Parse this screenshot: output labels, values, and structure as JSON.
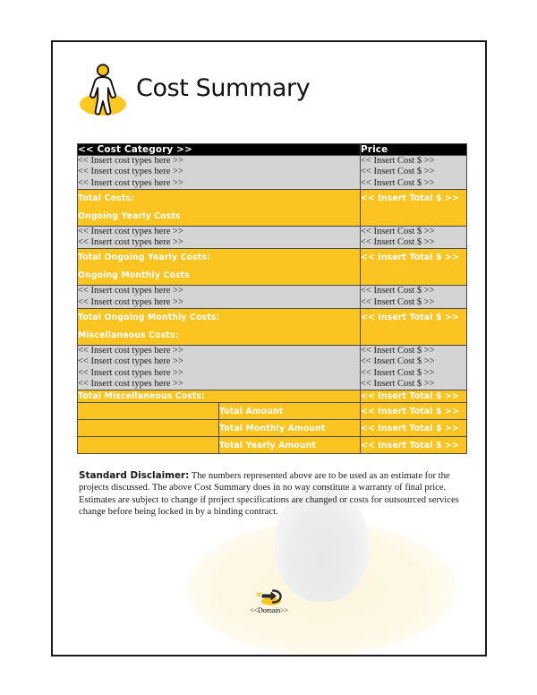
{
  "document": {
    "title": "Cost Summary",
    "logo_icon": "person-on-disc-icon"
  },
  "table": {
    "header": {
      "category": "<< Cost Category >>",
      "price": "Price"
    },
    "item_placeholder": "<< Insert cost types here >>",
    "cost_placeholder": "<< Insert Cost $ >>",
    "total_placeholder": "<< Insert Total $ >>",
    "sections": [
      {
        "kind": "items",
        "rows": 3
      },
      {
        "kind": "gold",
        "label_primary": "Total Costs:",
        "label_secondary": "Ongoing Yearly Costs",
        "value": "<< Insert Total $ >>"
      },
      {
        "kind": "items",
        "rows": 2
      },
      {
        "kind": "gold",
        "label_primary": "Total Ongoing Yearly Costs:",
        "label_secondary": "Ongoing Monthly Costs",
        "value": "<< Insert Total $ >>"
      },
      {
        "kind": "items",
        "rows": 2
      },
      {
        "kind": "gold",
        "label_primary": "Total Ongoing Monthly Costs:",
        "label_secondary": "Miscellaneous Costs:",
        "value": "<< Insert Total $ >>"
      },
      {
        "kind": "items",
        "rows": 4
      },
      {
        "kind": "gold-single",
        "label_primary": "Total Miscellaneous Costs:",
        "value": "<< Insert Total $ >>"
      }
    ],
    "summary_rows": [
      {
        "label": "Total Amount",
        "value": "<< Insert Total $ >>"
      },
      {
        "label": "Total Monthly Amount",
        "value": "<< Insert Total $ >>"
      },
      {
        "label": "Total Yearly Amount",
        "value": "<< Insert Total $ >>"
      }
    ]
  },
  "disclaimer": {
    "heading": "Standard Disclaimer:",
    "body": " The numbers represented above are to be used as an estimate for the projects discussed. The above Cost Summary does in no way constitute a warranty of final price. Estimates are subject to change if project specifications are changed or costs for outsourced services change before being locked in by a binding contract."
  },
  "footer": {
    "domain": "<<Domain>>",
    "logo_icon": "swoosh-arrow-icon"
  },
  "colors": {
    "gold": "#FBC420",
    "gray_row": "#D4D4D4",
    "header_black": "#000000",
    "text_dark": "#191919",
    "border": "#4A4A4A"
  }
}
